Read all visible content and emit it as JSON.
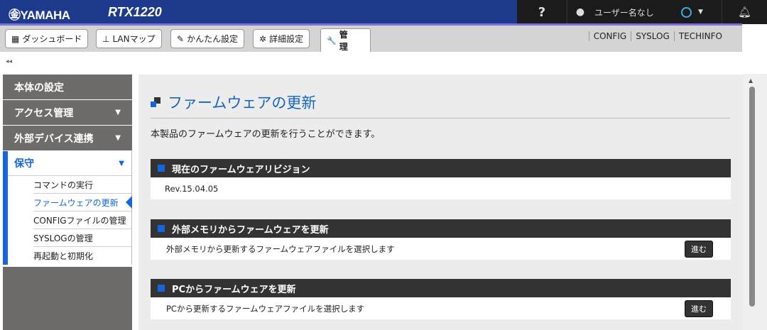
{
  "header": {
    "logo": "㊎YAMAHA",
    "model": "RTX1220",
    "help": "?",
    "user": "ユーザー名なし"
  },
  "toolbar": {
    "tabs": [
      {
        "icon": "▦",
        "label": "ダッシュボード"
      },
      {
        "icon": "⊥",
        "label": "LANマップ"
      },
      {
        "icon": "✎",
        "label": "かんたん設定"
      },
      {
        "icon": "✲",
        "label": "詳細設定"
      },
      {
        "icon": "🔧",
        "label": "管　理"
      }
    ],
    "links": [
      "CONFIG",
      "SYSLOG",
      "TECHINFO"
    ]
  },
  "collapse": "◂◂",
  "sidebar": {
    "items": [
      "本体の設定",
      "アクセス管理",
      "外部デバイス連携"
    ],
    "active": "保守",
    "sub": [
      "コマンドの実行",
      "ファームウェアの更新",
      "CONFIGファイルの管理",
      "SYSLOGの管理",
      "再起動と初期化"
    ]
  },
  "main": {
    "title": "ファームウェアの更新",
    "desc": "本製品のファームウェアの更新を行うことができます。",
    "sections": [
      {
        "title": "現在のファームウェアリビジョン",
        "text": "Rev.15.04.05"
      },
      {
        "title": "外部メモリからファームウェアを更新",
        "text": "外部メモリから更新するファームウェアファイルを選択します",
        "button": "進む"
      },
      {
        "title": "PCからファームウェアを更新",
        "text": "PCから更新するファームウェアファイルを選択します",
        "button": "進む"
      }
    ]
  }
}
